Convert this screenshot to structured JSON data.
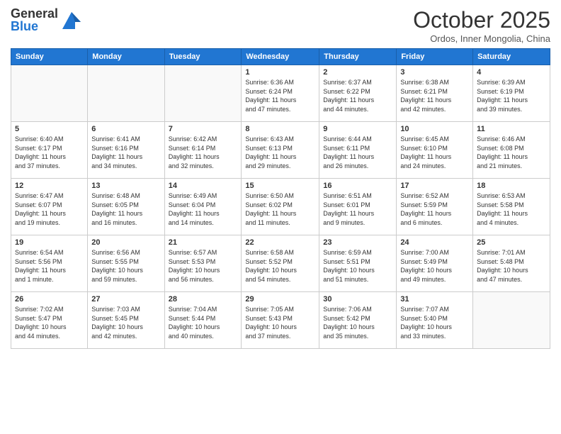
{
  "logo": {
    "general": "General",
    "blue": "Blue"
  },
  "title": "October 2025",
  "subtitle": "Ordos, Inner Mongolia, China",
  "headers": [
    "Sunday",
    "Monday",
    "Tuesday",
    "Wednesday",
    "Thursday",
    "Friday",
    "Saturday"
  ],
  "weeks": [
    [
      {
        "day": "",
        "info": ""
      },
      {
        "day": "",
        "info": ""
      },
      {
        "day": "",
        "info": ""
      },
      {
        "day": "1",
        "info": "Sunrise: 6:36 AM\nSunset: 6:24 PM\nDaylight: 11 hours\nand 47 minutes."
      },
      {
        "day": "2",
        "info": "Sunrise: 6:37 AM\nSunset: 6:22 PM\nDaylight: 11 hours\nand 44 minutes."
      },
      {
        "day": "3",
        "info": "Sunrise: 6:38 AM\nSunset: 6:21 PM\nDaylight: 11 hours\nand 42 minutes."
      },
      {
        "day": "4",
        "info": "Sunrise: 6:39 AM\nSunset: 6:19 PM\nDaylight: 11 hours\nand 39 minutes."
      }
    ],
    [
      {
        "day": "5",
        "info": "Sunrise: 6:40 AM\nSunset: 6:17 PM\nDaylight: 11 hours\nand 37 minutes."
      },
      {
        "day": "6",
        "info": "Sunrise: 6:41 AM\nSunset: 6:16 PM\nDaylight: 11 hours\nand 34 minutes."
      },
      {
        "day": "7",
        "info": "Sunrise: 6:42 AM\nSunset: 6:14 PM\nDaylight: 11 hours\nand 32 minutes."
      },
      {
        "day": "8",
        "info": "Sunrise: 6:43 AM\nSunset: 6:13 PM\nDaylight: 11 hours\nand 29 minutes."
      },
      {
        "day": "9",
        "info": "Sunrise: 6:44 AM\nSunset: 6:11 PM\nDaylight: 11 hours\nand 26 minutes."
      },
      {
        "day": "10",
        "info": "Sunrise: 6:45 AM\nSunset: 6:10 PM\nDaylight: 11 hours\nand 24 minutes."
      },
      {
        "day": "11",
        "info": "Sunrise: 6:46 AM\nSunset: 6:08 PM\nDaylight: 11 hours\nand 21 minutes."
      }
    ],
    [
      {
        "day": "12",
        "info": "Sunrise: 6:47 AM\nSunset: 6:07 PM\nDaylight: 11 hours\nand 19 minutes."
      },
      {
        "day": "13",
        "info": "Sunrise: 6:48 AM\nSunset: 6:05 PM\nDaylight: 11 hours\nand 16 minutes."
      },
      {
        "day": "14",
        "info": "Sunrise: 6:49 AM\nSunset: 6:04 PM\nDaylight: 11 hours\nand 14 minutes."
      },
      {
        "day": "15",
        "info": "Sunrise: 6:50 AM\nSunset: 6:02 PM\nDaylight: 11 hours\nand 11 minutes."
      },
      {
        "day": "16",
        "info": "Sunrise: 6:51 AM\nSunset: 6:01 PM\nDaylight: 11 hours\nand 9 minutes."
      },
      {
        "day": "17",
        "info": "Sunrise: 6:52 AM\nSunset: 5:59 PM\nDaylight: 11 hours\nand 6 minutes."
      },
      {
        "day": "18",
        "info": "Sunrise: 6:53 AM\nSunset: 5:58 PM\nDaylight: 11 hours\nand 4 minutes."
      }
    ],
    [
      {
        "day": "19",
        "info": "Sunrise: 6:54 AM\nSunset: 5:56 PM\nDaylight: 11 hours\nand 1 minute."
      },
      {
        "day": "20",
        "info": "Sunrise: 6:56 AM\nSunset: 5:55 PM\nDaylight: 10 hours\nand 59 minutes."
      },
      {
        "day": "21",
        "info": "Sunrise: 6:57 AM\nSunset: 5:53 PM\nDaylight: 10 hours\nand 56 minutes."
      },
      {
        "day": "22",
        "info": "Sunrise: 6:58 AM\nSunset: 5:52 PM\nDaylight: 10 hours\nand 54 minutes."
      },
      {
        "day": "23",
        "info": "Sunrise: 6:59 AM\nSunset: 5:51 PM\nDaylight: 10 hours\nand 51 minutes."
      },
      {
        "day": "24",
        "info": "Sunrise: 7:00 AM\nSunset: 5:49 PM\nDaylight: 10 hours\nand 49 minutes."
      },
      {
        "day": "25",
        "info": "Sunrise: 7:01 AM\nSunset: 5:48 PM\nDaylight: 10 hours\nand 47 minutes."
      }
    ],
    [
      {
        "day": "26",
        "info": "Sunrise: 7:02 AM\nSunset: 5:47 PM\nDaylight: 10 hours\nand 44 minutes."
      },
      {
        "day": "27",
        "info": "Sunrise: 7:03 AM\nSunset: 5:45 PM\nDaylight: 10 hours\nand 42 minutes."
      },
      {
        "day": "28",
        "info": "Sunrise: 7:04 AM\nSunset: 5:44 PM\nDaylight: 10 hours\nand 40 minutes."
      },
      {
        "day": "29",
        "info": "Sunrise: 7:05 AM\nSunset: 5:43 PM\nDaylight: 10 hours\nand 37 minutes."
      },
      {
        "day": "30",
        "info": "Sunrise: 7:06 AM\nSunset: 5:42 PM\nDaylight: 10 hours\nand 35 minutes."
      },
      {
        "day": "31",
        "info": "Sunrise: 7:07 AM\nSunset: 5:40 PM\nDaylight: 10 hours\nand 33 minutes."
      },
      {
        "day": "",
        "info": ""
      }
    ]
  ]
}
